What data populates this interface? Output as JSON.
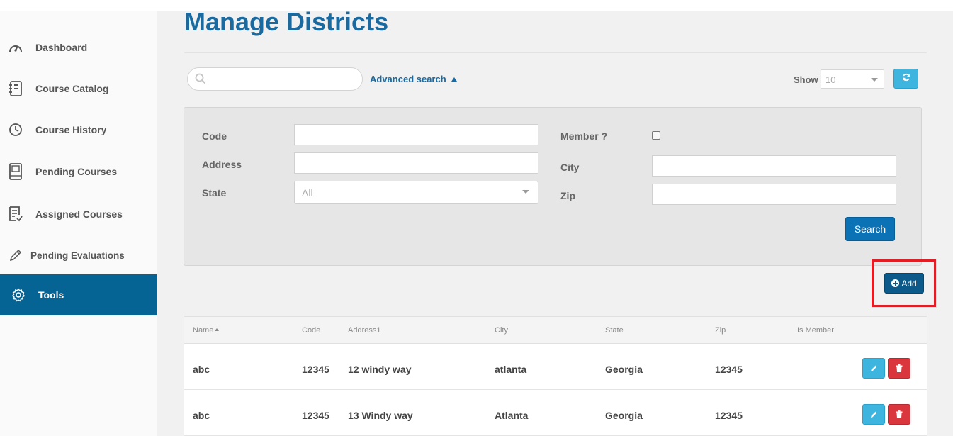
{
  "sidebar": {
    "items": [
      {
        "label": "Dashboard",
        "icon": "dashboard-gauge-icon"
      },
      {
        "label": "Course Catalog",
        "icon": "catalog-icon"
      },
      {
        "label": "Course History",
        "icon": "history-clock-icon"
      },
      {
        "label": "Pending Courses",
        "icon": "book-icon"
      },
      {
        "label": "Assigned Courses",
        "icon": "checklist-icon"
      },
      {
        "label": "Pending Evaluations",
        "icon": "pencil-icon"
      },
      {
        "label": "Tools",
        "icon": "gear-icon",
        "active": true
      }
    ]
  },
  "page": {
    "title": "Manage Districts"
  },
  "search": {
    "placeholder": "",
    "advanced_label": "Advanced search"
  },
  "show": {
    "label": "Show",
    "value": "10"
  },
  "filters": {
    "code_label": "Code",
    "address_label": "Address",
    "state_label": "State",
    "state_value": "All",
    "member_label": "Member ?",
    "city_label": "City",
    "zip_label": "Zip",
    "search_button": "Search"
  },
  "add_button": "Add",
  "table": {
    "headers": [
      "Name",
      "Code",
      "Address1",
      "City",
      "State",
      "Zip",
      "Is Member"
    ],
    "rows": [
      {
        "name": "abc",
        "code": "12345",
        "address1": "12 windy way",
        "city": "atlanta",
        "state": "Georgia",
        "zip": "12345"
      },
      {
        "name": "abc",
        "code": "12345",
        "address1": "13 Windy way",
        "city": "Atlanta",
        "state": "Georgia",
        "zip": "12345"
      }
    ]
  },
  "colors": {
    "accent": "#066494",
    "title": "#1a6aa0",
    "info": "#3db5df",
    "danger": "#d9363e",
    "highlight": "#e21d26"
  }
}
